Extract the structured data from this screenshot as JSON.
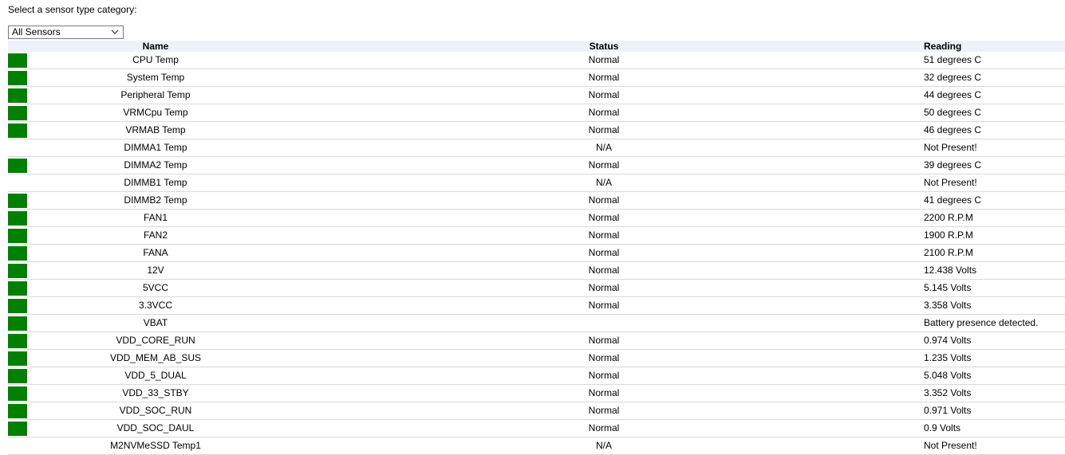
{
  "prompt": "Select a sensor type category:",
  "category_select": {
    "selected": "All Sensors"
  },
  "table": {
    "headers": {
      "name": "Name",
      "status": "Status",
      "reading": "Reading"
    },
    "rows": [
      {
        "name": "CPU Temp",
        "status": "Normal",
        "reading": "51 degrees C",
        "ok": true
      },
      {
        "name": "System Temp",
        "status": "Normal",
        "reading": "32 degrees C",
        "ok": true
      },
      {
        "name": "Peripheral Temp",
        "status": "Normal",
        "reading": "44 degrees C",
        "ok": true
      },
      {
        "name": "VRMCpu Temp",
        "status": "Normal",
        "reading": "50 degrees C",
        "ok": true
      },
      {
        "name": "VRMAB Temp",
        "status": "Normal",
        "reading": "46 degrees C",
        "ok": true
      },
      {
        "name": "DIMMA1 Temp",
        "status": "N/A",
        "reading": "Not Present!",
        "ok": false
      },
      {
        "name": "DIMMA2 Temp",
        "status": "Normal",
        "reading": "39 degrees C",
        "ok": true
      },
      {
        "name": "DIMMB1 Temp",
        "status": "N/A",
        "reading": "Not Present!",
        "ok": false
      },
      {
        "name": "DIMMB2 Temp",
        "status": "Normal",
        "reading": "41 degrees C",
        "ok": true
      },
      {
        "name": "FAN1",
        "status": "Normal",
        "reading": "2200 R.P.M",
        "ok": true
      },
      {
        "name": "FAN2",
        "status": "Normal",
        "reading": "1900 R.P.M",
        "ok": true
      },
      {
        "name": "FANA",
        "status": "Normal",
        "reading": "2100 R.P.M",
        "ok": true
      },
      {
        "name": "12V",
        "status": "Normal",
        "reading": "12.438 Volts",
        "ok": true
      },
      {
        "name": "5VCC",
        "status": "Normal",
        "reading": "5.145 Volts",
        "ok": true
      },
      {
        "name": "3.3VCC",
        "status": "Normal",
        "reading": "3.358 Volts",
        "ok": true
      },
      {
        "name": "VBAT",
        "status": "",
        "reading": "Battery presence detected.",
        "ok": true
      },
      {
        "name": "VDD_CORE_RUN",
        "status": "Normal",
        "reading": "0.974 Volts",
        "ok": true
      },
      {
        "name": "VDD_MEM_AB_SUS",
        "status": "Normal",
        "reading": "1.235 Volts",
        "ok": true
      },
      {
        "name": "VDD_5_DUAL",
        "status": "Normal",
        "reading": "5.048 Volts",
        "ok": true
      },
      {
        "name": "VDD_33_STBY",
        "status": "Normal",
        "reading": "3.352 Volts",
        "ok": true
      },
      {
        "name": "VDD_SOC_RUN",
        "status": "Normal",
        "reading": "0.971 Volts",
        "ok": true
      },
      {
        "name": "VDD_SOC_DAUL",
        "status": "Normal",
        "reading": "0.9 Volts",
        "ok": true
      },
      {
        "name": "M2NVMeSSD Temp1",
        "status": "N/A",
        "reading": "Not Present!",
        "ok": false
      }
    ]
  },
  "colors": {
    "status_ok": "#008000",
    "header_bg": "#eef2f8",
    "row_border": "#d9d9d9"
  },
  "icons": {
    "dropdown": "chevron-down-icon"
  }
}
